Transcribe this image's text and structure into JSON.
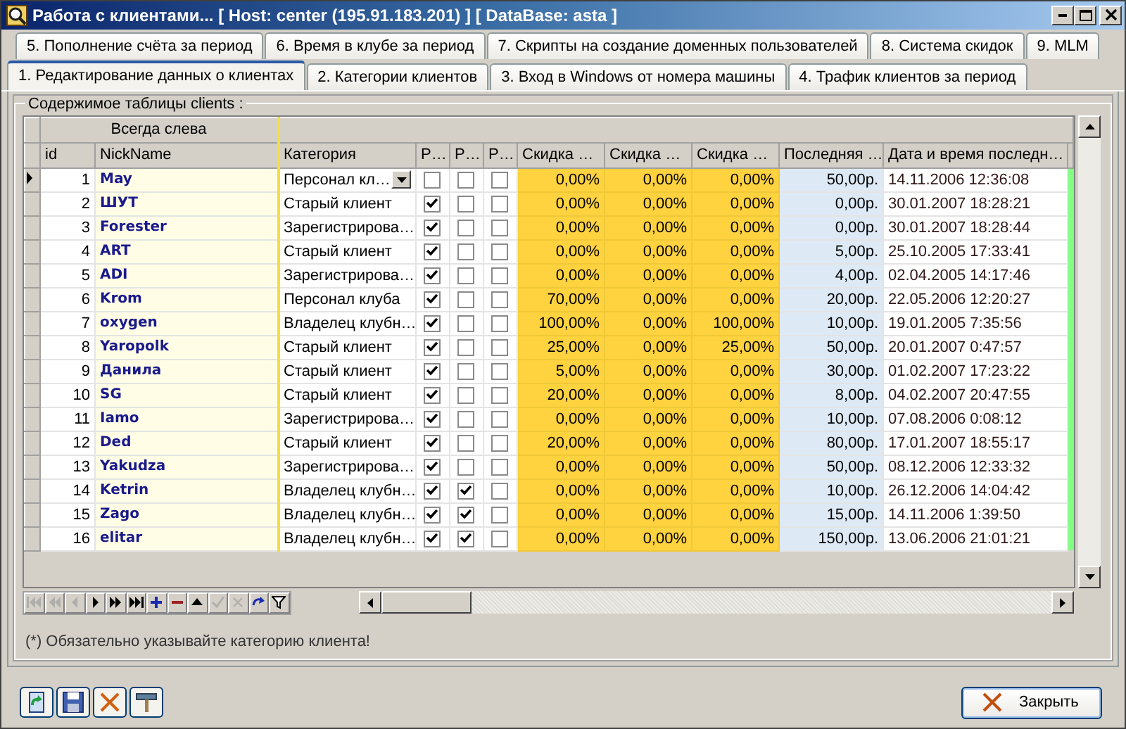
{
  "window": {
    "title": "Работа с клиентами... [ Host: center (195.91.183.201) ] [ DataBase: asta ]"
  },
  "tab_rows": [
    [
      {
        "label": "5. Пополнение счёта за период",
        "selected": false
      },
      {
        "label": "6. Время в клубе за период",
        "selected": false
      },
      {
        "label": "7. Скрипты на создание доменных пользователей",
        "selected": false
      },
      {
        "label": "8. Система скидок",
        "selected": false
      },
      {
        "label": "9. MLM",
        "selected": false
      }
    ],
    [
      {
        "label": "1. Редактирование данных о клиентах",
        "selected": true
      },
      {
        "label": "2. Категории клиентов",
        "selected": false
      },
      {
        "label": "3. Вход в Windows от номера машины",
        "selected": false
      },
      {
        "label": "4. Трафик клиентов за период",
        "selected": false
      }
    ]
  ],
  "group": {
    "title": "Содержимое таблицы clients :"
  },
  "grid": {
    "band_label": "Всегда слева",
    "columns": [
      "id",
      "NickName",
      "Категория",
      "Р…",
      "Р…",
      "Р…",
      "Скидка …",
      "Скидка …",
      "Скидка …",
      "Последняя …",
      "Дата и время последн…"
    ],
    "rows": [
      {
        "selected": true,
        "id": "1",
        "nick": "May",
        "category": "Персонал кл…",
        "checks": [
          false,
          false,
          false
        ],
        "discounts": [
          "0,00%",
          "0,00%",
          "0,00%"
        ],
        "last": "50,00р.",
        "date": "14.11.2006 12:36:08"
      },
      {
        "selected": false,
        "id": "2",
        "nick": "ШУТ",
        "category": "Старый клиент",
        "checks": [
          true,
          false,
          false
        ],
        "discounts": [
          "0,00%",
          "0,00%",
          "0,00%"
        ],
        "last": "0,00р.",
        "date": "30.01.2007 18:28:21"
      },
      {
        "selected": false,
        "id": "3",
        "nick": "Forester",
        "category": "Зарегистрирова…",
        "checks": [
          true,
          false,
          false
        ],
        "discounts": [
          "0,00%",
          "0,00%",
          "0,00%"
        ],
        "last": "0,00р.",
        "date": "30.01.2007 18:28:44"
      },
      {
        "selected": false,
        "id": "4",
        "nick": "ART",
        "category": "Старый клиент",
        "checks": [
          true,
          false,
          false
        ],
        "discounts": [
          "0,00%",
          "0,00%",
          "0,00%"
        ],
        "last": "5,00р.",
        "date": "25.10.2005 17:33:41"
      },
      {
        "selected": false,
        "id": "5",
        "nick": "ADI",
        "category": "Зарегистрирова…",
        "checks": [
          true,
          false,
          false
        ],
        "discounts": [
          "0,00%",
          "0,00%",
          "0,00%"
        ],
        "last": "4,00р.",
        "date": "02.04.2005 14:17:46"
      },
      {
        "selected": false,
        "id": "6",
        "nick": "Krom",
        "category": "Персонал клуба",
        "checks": [
          true,
          false,
          false
        ],
        "discounts": [
          "70,00%",
          "0,00%",
          "0,00%"
        ],
        "last": "20,00р.",
        "date": "22.05.2006 12:20:27"
      },
      {
        "selected": false,
        "id": "7",
        "nick": "oxygen",
        "category": "Владелец клубн…",
        "checks": [
          true,
          false,
          false
        ],
        "discounts": [
          "100,00%",
          "0,00%",
          "100,00%"
        ],
        "last": "10,00р.",
        "date": "19.01.2005 7:35:56"
      },
      {
        "selected": false,
        "id": "8",
        "nick": "Yaropolk",
        "category": "Старый клиент",
        "checks": [
          true,
          false,
          false
        ],
        "discounts": [
          "25,00%",
          "0,00%",
          "25,00%"
        ],
        "last": "50,00р.",
        "date": "20.01.2007 0:47:57"
      },
      {
        "selected": false,
        "id": "9",
        "nick": "Данила",
        "category": "Старый клиент",
        "checks": [
          true,
          false,
          false
        ],
        "discounts": [
          "5,00%",
          "0,00%",
          "0,00%"
        ],
        "last": "30,00р.",
        "date": "01.02.2007 17:23:22"
      },
      {
        "selected": false,
        "id": "10",
        "nick": "SG",
        "category": "Старый клиент",
        "checks": [
          true,
          false,
          false
        ],
        "discounts": [
          "20,00%",
          "0,00%",
          "0,00%"
        ],
        "last": "8,00р.",
        "date": "04.02.2007 20:47:55"
      },
      {
        "selected": false,
        "id": "11",
        "nick": "Iamo",
        "category": "Зарегистрирова…",
        "checks": [
          true,
          false,
          false
        ],
        "discounts": [
          "0,00%",
          "0,00%",
          "0,00%"
        ],
        "last": "10,00р.",
        "date": "07.08.2006 0:08:12"
      },
      {
        "selected": false,
        "id": "12",
        "nick": "Ded",
        "category": "Старый клиент",
        "checks": [
          true,
          false,
          false
        ],
        "discounts": [
          "20,00%",
          "0,00%",
          "0,00%"
        ],
        "last": "80,00р.",
        "date": "17.01.2007 18:55:17"
      },
      {
        "selected": false,
        "id": "13",
        "nick": "Yakudza",
        "category": "Зарегистрирова…",
        "checks": [
          true,
          false,
          false
        ],
        "discounts": [
          "0,00%",
          "0,00%",
          "0,00%"
        ],
        "last": "50,00р.",
        "date": "08.12.2006 12:33:32"
      },
      {
        "selected": false,
        "id": "14",
        "nick": "Ketrin",
        "category": "Владелец клубн…",
        "checks": [
          true,
          true,
          false
        ],
        "discounts": [
          "0,00%",
          "0,00%",
          "0,00%"
        ],
        "last": "10,00р.",
        "date": "26.12.2006 14:04:42"
      },
      {
        "selected": false,
        "id": "15",
        "nick": "Zago",
        "category": "Владелец клубн…",
        "checks": [
          true,
          true,
          false
        ],
        "discounts": [
          "0,00%",
          "0,00%",
          "0,00%"
        ],
        "last": "15,00р.",
        "date": "14.11.2006 1:39:50"
      },
      {
        "selected": false,
        "id": "16",
        "nick": "elitar",
        "category": "Владелец клубн…",
        "checks": [
          true,
          true,
          false
        ],
        "discounts": [
          "0,00%",
          "0,00%",
          "0,00%"
        ],
        "last": "150,00р.",
        "date": "13.06.2006 21:01:21"
      }
    ]
  },
  "navigator": [
    {
      "kind": "first",
      "disabled": true
    },
    {
      "kind": "prior_page",
      "disabled": true
    },
    {
      "kind": "prior",
      "disabled": true
    },
    {
      "kind": "next",
      "disabled": false
    },
    {
      "kind": "next_page",
      "disabled": false
    },
    {
      "kind": "last",
      "disabled": false
    },
    {
      "kind": "insert",
      "disabled": false
    },
    {
      "kind": "delete",
      "disabled": false
    },
    {
      "kind": "edit",
      "disabled": false
    },
    {
      "kind": "post",
      "disabled": true
    },
    {
      "kind": "cancel",
      "disabled": true
    },
    {
      "kind": "refresh",
      "disabled": false
    },
    {
      "kind": "filter",
      "disabled": false
    }
  ],
  "note": "(*) Обязательно указывайте категорию клиента!",
  "toolbar_buttons": [
    {
      "kind": "refresh"
    },
    {
      "kind": "save"
    },
    {
      "kind": "delete"
    },
    {
      "kind": "tools"
    }
  ],
  "close_button": {
    "label": "Закрыть"
  }
}
